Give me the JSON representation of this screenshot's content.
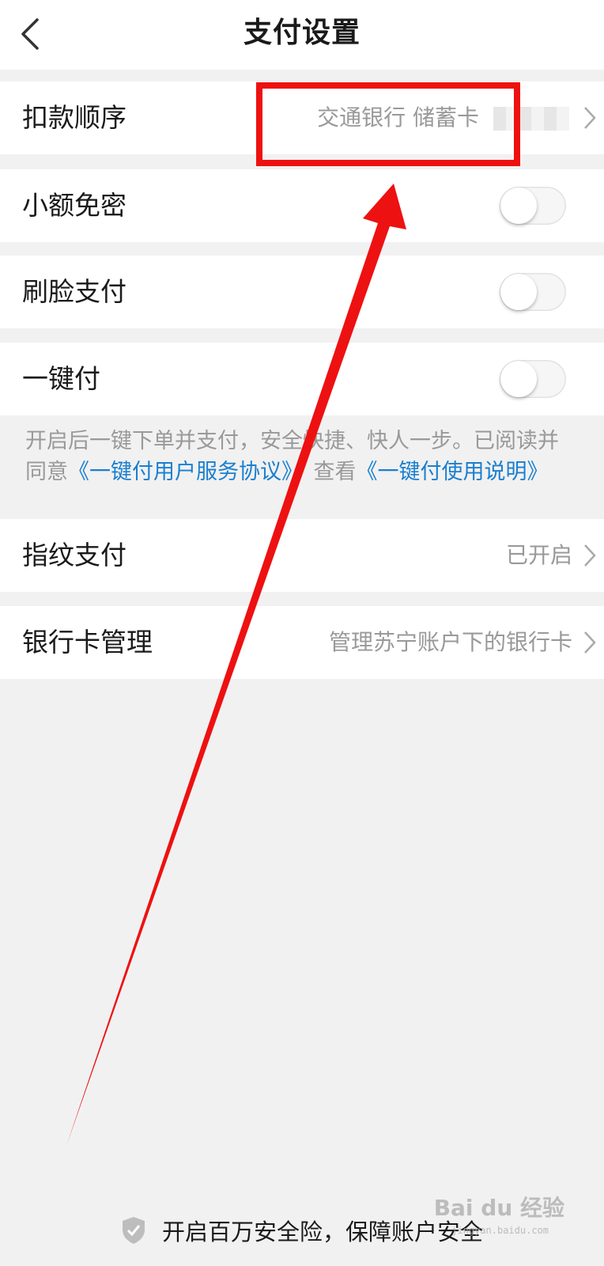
{
  "header": {
    "title": "支付设置",
    "back_icon": "chevron-left-icon"
  },
  "rows": {
    "deduction_order": {
      "label": "扣款顺序",
      "value": "交通银行 储蓄卡"
    },
    "small_password_free": {
      "label": "小额免密",
      "enabled": false
    },
    "face_pay": {
      "label": "刷脸支付",
      "enabled": false
    },
    "one_click_pay": {
      "label": "一键付",
      "enabled": false
    },
    "fingerprint_pay": {
      "label": "指纹支付",
      "value": "已开启"
    },
    "bank_card_manage": {
      "label": "银行卡管理",
      "value": "管理苏宁账户下的银行卡"
    }
  },
  "one_click_note": {
    "text_prefix": "开启后一键下单并支付，安全快捷、快人一步。已阅读并同意",
    "agreement_link": "《一键付用户服务协议》",
    "text_middle": "，查看",
    "guide_link": "《一键付使用说明》"
  },
  "footer": {
    "text": "开启百万安全险，保障账户安全",
    "icon": "shield-check-icon"
  },
  "watermark": {
    "brand": "Bai du 经验",
    "url": "jingyan.baidu.com"
  },
  "colors": {
    "link": "#1a7fd0",
    "annotation": "#ee1111",
    "secondary_text": "#999999"
  }
}
